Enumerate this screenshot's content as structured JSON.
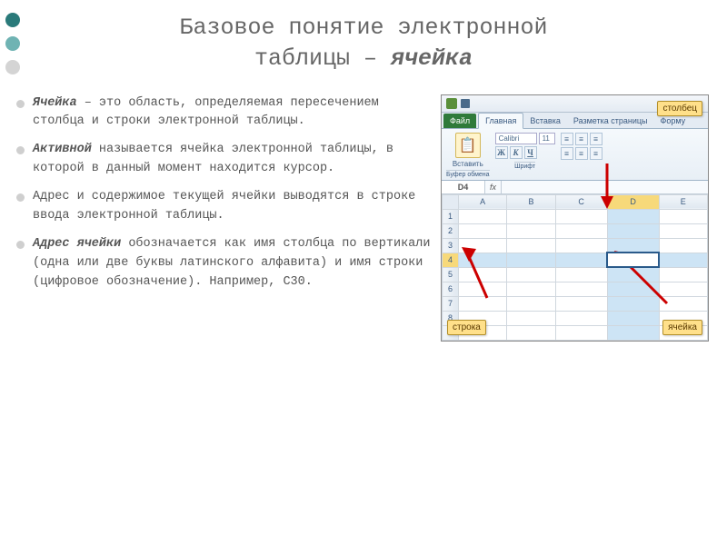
{
  "title": {
    "line1": "Базовое понятие электронной",
    "line2_a": "таблицы – ",
    "line2_b": "ячейка"
  },
  "bullets": [
    {
      "strong": "Ячейка",
      "rest": " – это область, определяемая пересечением столбца и строки электронной таблицы."
    },
    {
      "strong": "Активной",
      "rest": " называется ячейка электронной таблицы, в которой в данный момент находится курсор."
    },
    {
      "strong": "",
      "rest": "Адрес и содержимое текущей ячейки выводятся в строке ввода электронной таблицы."
    },
    {
      "strong": "Адрес ячейки",
      "rest": " обозначается как имя столбца по вертикали (одна или две буквы латинского алфавита) и имя строки (цифровое обозначение). Например, С30."
    }
  ],
  "excel": {
    "tabs": {
      "file": "Файл",
      "home": "Главная",
      "insert": "Вставка",
      "layout": "Разметка страницы",
      "formulas": "Форму"
    },
    "ribbon": {
      "paste": "Вставить",
      "clipboard": "Буфер обмена",
      "font_area": "Шрифт",
      "font_name": "Calibri",
      "font_size": "11"
    },
    "buttons": {
      "bold": "Ж",
      "italic": "К",
      "underline": "Ч"
    },
    "namebox": "D4",
    "fx_label": "fx",
    "columns": [
      "A",
      "B",
      "C",
      "D",
      "E"
    ],
    "rows": [
      "1",
      "2",
      "3",
      "4",
      "5",
      "6",
      "7",
      "8",
      "9"
    ],
    "callouts": {
      "column": "столбец",
      "row": "строка",
      "cell": "ячейка"
    }
  }
}
